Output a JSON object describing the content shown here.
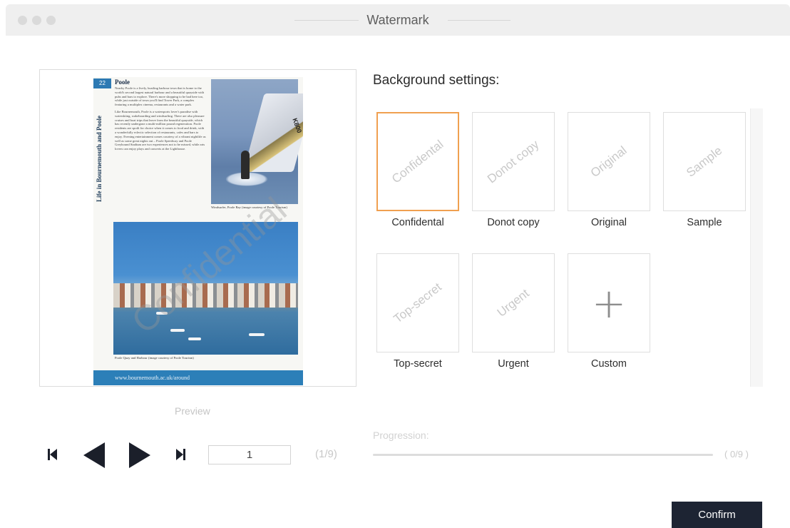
{
  "window": {
    "title": "Watermark"
  },
  "preview": {
    "label": "Preview",
    "watermark_text": "Confidential",
    "document": {
      "side_title": "Life in Bournemouth and Poole",
      "page_number": "22",
      "heading": "Poole",
      "paragraph_1": "Nearby Poole is a lively, bustling harbour town that is home to the world's second largest natural harbour and a beautiful quayside with pubs and bars to explore. There's more shopping to be had here too, while just outside of town you'll find Tower Park, a complex featuring a multiplex cinema, restaurants and a water park.",
      "paragraph_2": "Like Bournemouth, Poole is a watersports lover's paradise with waterskiing, wakeboarding and windsurfing. There are also pleasure cruises and boat trips that leave from the beautiful quayside, which has recently undergone a multi-million pound regeneration. Poole residents are spoilt for choice when it comes to food and drink, with a wonderfully eclectic selection of restaurants, cafes and bars to enjoy. Evening entertainment comes courtesy of a vibrant nightlife as well as some great nights out – Poole Speedway and Poole Greyhound Stadium are two experiences not to be missed, while arts lovers can enjoy plays and concerts at the Lighthouse.",
      "caption_top": "Windsurfer, Poole Bay (image courtesy of Poole Tourism)",
      "sail_label": "K800",
      "caption_bottom": "Poole Quay and Harbour (image courtesy of Poole Tourism)",
      "footer_link": "www.bournemouth.ac.uk/around"
    }
  },
  "navigation": {
    "current_page": "1",
    "page_count": "(1/9)"
  },
  "settings": {
    "title": "Background settings:",
    "tiles": [
      {
        "label": "Confidental",
        "watermark": "Confidental",
        "selected": true
      },
      {
        "label": "Donot copy",
        "watermark": "Donot copy",
        "selected": false
      },
      {
        "label": "Original",
        "watermark": "Original",
        "selected": false
      },
      {
        "label": "Sample",
        "watermark": "Sample",
        "selected": false
      },
      {
        "label": "Top-secret",
        "watermark": "Top-secret",
        "selected": false
      },
      {
        "label": "Urgent",
        "watermark": "Urgent",
        "selected": false
      },
      {
        "label": "Custom",
        "icon": "plus-icon",
        "selected": false
      }
    ]
  },
  "progression": {
    "label": "Progression:",
    "count": "( 0/9 )",
    "progress": 0
  },
  "actions": {
    "confirm_label": "Confirm"
  },
  "colors": {
    "selected_border": "#f0a050",
    "confirm_bg": "#1d2433",
    "footer_blue": "#2c7fb8"
  }
}
